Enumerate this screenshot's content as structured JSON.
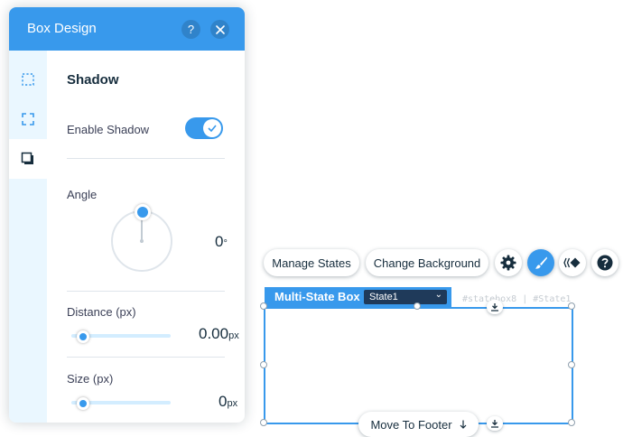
{
  "panel": {
    "title": "Box Design",
    "help_label": "?",
    "sidebar": [
      {
        "name": "fill-opacity-icon"
      },
      {
        "name": "corners-icon"
      },
      {
        "name": "shadow-icon",
        "active": true
      }
    ],
    "section_title": "Shadow",
    "enable_shadow": {
      "label": "Enable Shadow",
      "enabled": true
    },
    "angle": {
      "label": "Angle",
      "value": "0",
      "unit": "°"
    },
    "distance": {
      "label": "Distance (px)",
      "value": "0.00",
      "unit": "px",
      "level": 0
    },
    "size": {
      "label": "Size (px)",
      "value": "0",
      "unit": "px",
      "level": 0
    }
  },
  "toolbar": {
    "manage_states": "Manage States",
    "change_background": "Change Background",
    "icons": [
      "gear-icon",
      "brush-icon",
      "animation-icon",
      "help-icon"
    ]
  },
  "multistate": {
    "tag_label": "Multi-State Box",
    "state_selected": "State1",
    "id_text": "#statebox8 | #State1",
    "move_to_footer": "Move To Footer"
  },
  "colors": {
    "accent": "#3899ec",
    "dark_navy": "#1f3a5a",
    "sidebar_bg": "#eaf7ff"
  }
}
